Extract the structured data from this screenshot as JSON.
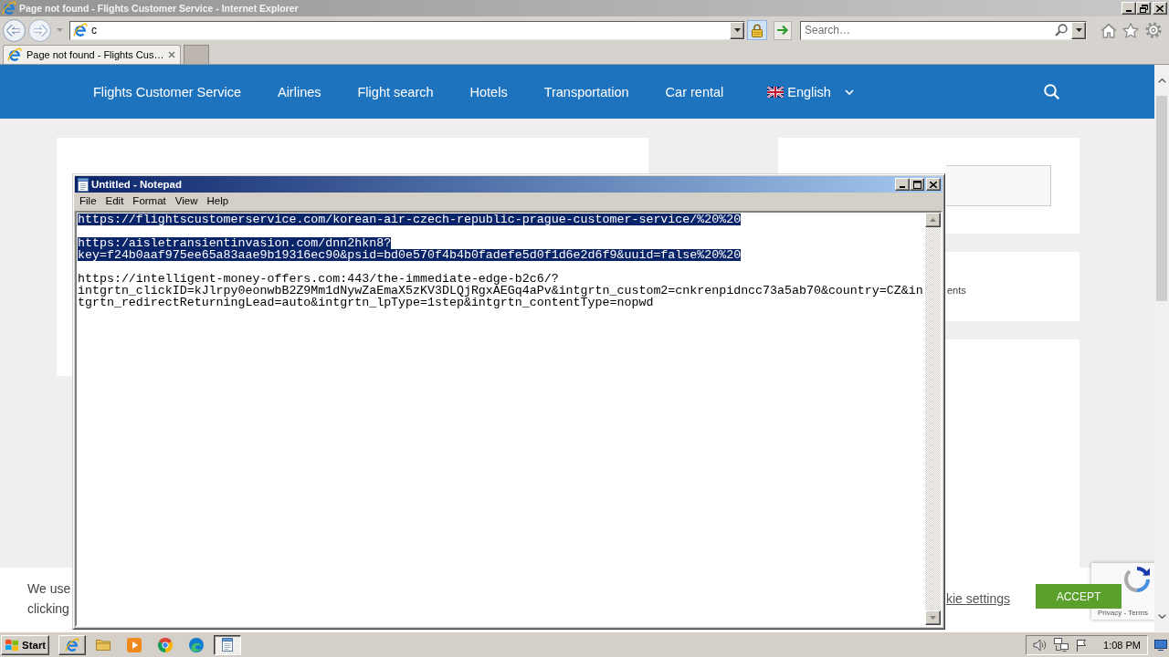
{
  "browser": {
    "title": "Page not found - Flights Customer Service - Internet Explorer",
    "address": "c",
    "search_placeholder": "Search…",
    "tabs": [
      {
        "label": "Page not found - Flights Cus…",
        "selected": true
      }
    ]
  },
  "site": {
    "nav": [
      "Flights Customer Service",
      "Airlines",
      "Flight search",
      "Hotels",
      "Transportation",
      "Car rental"
    ],
    "language": "English",
    "sidebar_text": "ents",
    "cookie_lines": [
      "We use",
      "clicking"
    ],
    "cookie_link": "kie settings",
    "accept_button": "ACCEPT",
    "recaptcha_links": "Privacy - Terms"
  },
  "notepad": {
    "title": "Untitled - Notepad",
    "menu": [
      "File",
      "Edit",
      "Format",
      "View",
      "Help"
    ],
    "blocks": [
      {
        "selected": true,
        "lines": [
          "https://flightscustomerservice.com/korean-air-czech-republic-prague-customer-service/%20%20"
        ]
      },
      {
        "selected": true,
        "lines": [
          "https:/aisletransientinvasion.com/dnn2hkn8?",
          "key=f24b0aaf975ee65a83aae9b19316ec90&psid=bd0e570f4b4b0fadefe5d0f1d6e2d6f9&uuid=false%20%20"
        ]
      },
      {
        "selected": false,
        "lines": [
          "https://intelligent-money-offers.com:443/the-immediate-edge-b2c6/?",
          "intgrtn_clickID=kJlrpy0eonwbB2Z9Mm1dNywZaEmaX5zKV3DLQjRgxAEGq4aPv&intgrtn_custom2=cnkrenpidncc73a5ab70&country=CZ&in",
          "tgrtn_redirectReturningLead=auto&intgrtn_lpType=1step&intgrtn_contentType=nopwd"
        ]
      }
    ]
  },
  "taskbar": {
    "start": "Start",
    "apps": [
      {
        "kind": "ie",
        "open": true,
        "selected": false
      },
      {
        "kind": "folder",
        "open": false,
        "selected": false
      },
      {
        "kind": "media",
        "open": false,
        "selected": false
      },
      {
        "kind": "chrome",
        "open": false,
        "selected": false
      },
      {
        "kind": "edge",
        "open": false,
        "selected": false
      },
      {
        "kind": "notepad",
        "open": true,
        "selected": true
      }
    ],
    "clock": "1:08 PM"
  }
}
